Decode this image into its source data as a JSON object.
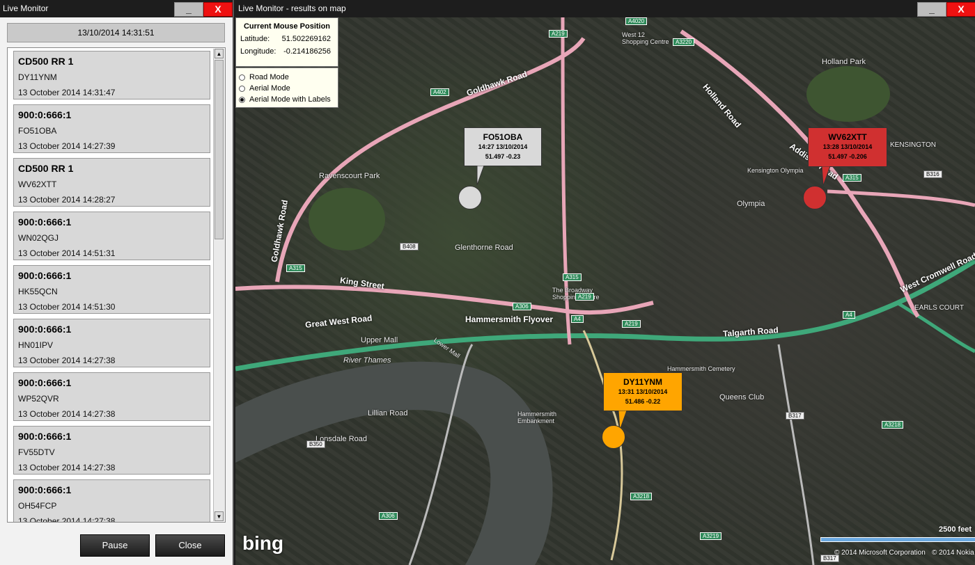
{
  "left_window": {
    "title": "Live Monitor",
    "minimize": "_",
    "close": "X",
    "datetime": "13/10/2014 14:31:51",
    "items": [
      {
        "title": "CD500 RR 1",
        "plate": "DY11YNM",
        "time": "13 October 2014 14:31:47",
        "color": "#ffa500"
      },
      {
        "title": "900:0:666:1",
        "plate": "FO51OBA",
        "time": "13 October 2014 14:27:39",
        "color": "#d8d8d8"
      },
      {
        "title": "CD500 RR 1",
        "plate": "WV62XTT",
        "time": "13 October 2014 14:28:27",
        "color": "#d03030"
      },
      {
        "title": "900:0:666:1",
        "plate": "WN02QGJ",
        "time": "13 October 2014 14:51:31",
        "color": "#d8d8d8"
      },
      {
        "title": "900:0:666:1",
        "plate": "HK55QCN",
        "time": "13 October 2014 14:51:30",
        "color": "#d8d8d8"
      },
      {
        "title": "900:0:666:1",
        "plate": "HN01IPV",
        "time": "13 October 2014 14:27:38",
        "color": "#d8d8d8"
      },
      {
        "title": "900:0:666:1",
        "plate": "WP52QVR",
        "time": "13 October 2014 14:27:38",
        "color": "#d8d8d8"
      },
      {
        "title": "900:0:666:1",
        "plate": "FV55DTV",
        "time": "13 October 2014 14:27:38",
        "color": "#d8d8d8"
      },
      {
        "title": "900:0:666:1",
        "plate": "OH54FCP",
        "time": "13 October 2014 14:27:38",
        "color": "#d8d8d8"
      }
    ],
    "pause_label": "Pause",
    "close_label": "Close"
  },
  "right_window": {
    "title": "Live Monitor - results on map",
    "minimize": "_",
    "close": "X",
    "mouse_position": {
      "heading": "Current Mouse Position",
      "lat_label": "Latitude:",
      "lat_value": "51.502269162",
      "lon_label": "Longitude:",
      "lon_value": "-0.214186256"
    },
    "modes": [
      {
        "label": "Road Mode",
        "selected": false
      },
      {
        "label": "Aerial Mode",
        "selected": false
      },
      {
        "label": "Aerial Mode with Labels",
        "selected": true
      }
    ],
    "markers": [
      {
        "plate": "FO51OBA",
        "datetime": "14:27 13/10/2014",
        "latlon": "51.497 -0.23",
        "color": "#d9d9d9"
      },
      {
        "plate": "WV62XTT",
        "datetime": "13:28 13/10/2014",
        "latlon": "51.497 -0.206",
        "color": "#d03030"
      },
      {
        "plate": "DY11YNM",
        "datetime": "13:31 13/10/2014",
        "latlon": "51.486 -0.22",
        "color": "#ffa500"
      }
    ],
    "map_labels": {
      "goldhawk_road": "Goldhawk Road",
      "goldhawk_road_2": "Goldhawk Road",
      "holland_road": "Holland Road",
      "addison_road": "Addison Road",
      "king_street": "King Street",
      "great_west_road": "Great West Road",
      "hammersmith_flyover": "Hammersmith Flyover",
      "talgarth_road": "Talgarth Road",
      "west_cromwell_road": "West Cromwell Road",
      "river_thames": "River Thames",
      "ravenscourt_park": "Ravenscourt Park",
      "holland_park": "Holland Park",
      "olympia": "Olympia",
      "kensington_olympia": "Kensington Olympia",
      "queens_club": "Queens Club",
      "lonsdale_road": "Lonsdale Road",
      "lillian_road": "Lillian Road",
      "glenthorne_road": "Glenthorne Road",
      "hammersmith_cemetery": "Hammersmith Cemetery",
      "broadway": "The Broadway Shopping Centre",
      "westfield": "West 12 Shopping Centre",
      "earls_court": "EARLS COURT",
      "kensington": "KENSINGTON",
      "lower_mall": "Lower Mall",
      "upper_mall": "Upper Mall",
      "hammersmith_embankment": "Hammersmith Embankment"
    },
    "road_shields": [
      "A4020",
      "A219",
      "A3220",
      "A402",
      "B408",
      "A315",
      "A315",
      "A219",
      "A306",
      "A4",
      "A219",
      "A4",
      "A315",
      "B316",
      "B317",
      "B350",
      "A306",
      "A3218",
      "A3219",
      "B317",
      "A3218"
    ],
    "scale": "2500 feet",
    "logo": "bing",
    "copyright": "© 2014 Microsoft Corporation",
    "copyright2": "© 2014 Nokia"
  }
}
